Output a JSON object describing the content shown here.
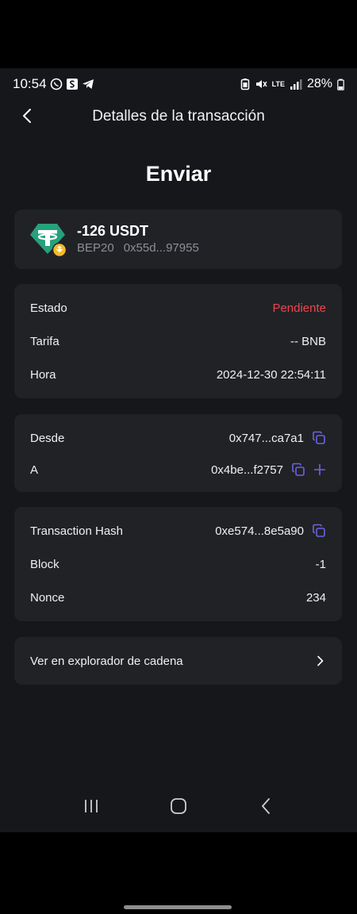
{
  "status_bar": {
    "time": "10:54",
    "battery": "28%",
    "network": "LTE",
    "icons": [
      "whatsapp-icon",
      "s-app-icon",
      "telegram-icon",
      "battery-saver-icon",
      "mute-icon",
      "lte-icon",
      "signal-icon",
      "battery-icon"
    ]
  },
  "header": {
    "title": "Detalles de la transacción",
    "back_icon": "chevron-left-icon"
  },
  "page_heading": "Enviar",
  "token": {
    "amount": "-126 USDT",
    "network": "BEP20",
    "address_short": "0x55d...97955",
    "icon": "usdt-token-icon",
    "badge_icon": "bnb-badge-icon"
  },
  "details": {
    "status_label": "Estado",
    "status_value": "Pendiente",
    "fee_label": "Tarifa",
    "fee_value": "-- BNB",
    "time_label": "Hora",
    "time_value": "2024-12-30 22:54:11"
  },
  "addresses": {
    "from_label": "Desde",
    "from_value": "0x747...ca7a1",
    "to_label": "A",
    "to_value": "0x4be...f2757"
  },
  "tx": {
    "hash_label": "Transaction Hash",
    "hash_value": "0xe574...8e5a90",
    "block_label": "Block",
    "block_value": "-1",
    "nonce_label": "Nonce",
    "nonce_value": "234"
  },
  "explorer": {
    "label": "Ver en explorador de cadena",
    "icon": "chevron-right-icon"
  },
  "colors": {
    "background": "#16171b",
    "card": "#212226",
    "pending": "#f0434e",
    "accent": "#6b63e0",
    "tether": "#26a17b",
    "bnb": "#f3ba2f"
  }
}
